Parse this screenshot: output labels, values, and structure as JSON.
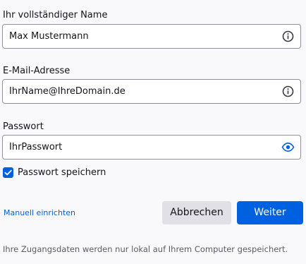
{
  "form": {
    "name_label": "Ihr vollständiger Name",
    "name_value": "Max Mustermann",
    "email_label": "E-Mail-Adresse",
    "email_value": "IhrName@IhreDomain.de",
    "password_label": "Passwort",
    "password_value": "IhrPasswort",
    "remember_label": "Passwort speichern",
    "remember_checked": true
  },
  "actions": {
    "manual_link": "Manuell einrichten",
    "cancel_label": "Abbrechen",
    "continue_label": "Weiter"
  },
  "footer": {
    "note": "Ihre Zugangsdaten werden nur lokal auf Ihrem Computer gespeichert."
  },
  "icons": {
    "name_info": "info-icon",
    "email_info": "info-icon",
    "password_toggle": "eye-icon",
    "checkbox_mark": "checkmark-icon"
  },
  "colors": {
    "accent": "#0061e0",
    "background": "#f9f9fb",
    "secondary_button": "#e0e0e6",
    "field_border": "#8f8f9d",
    "muted_text": "#5b5b66"
  }
}
